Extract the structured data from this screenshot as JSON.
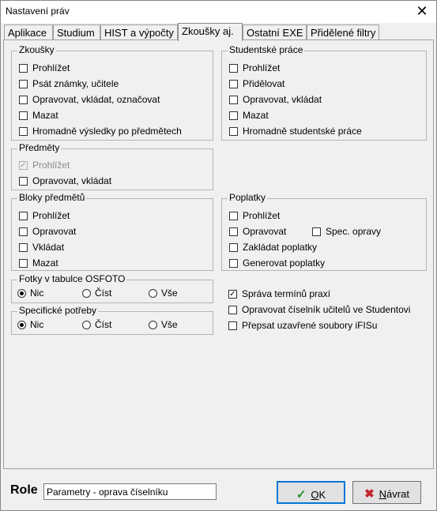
{
  "window": {
    "title": "Nastavení práv",
    "close_symbol": "✕"
  },
  "tabs": [
    "Aplikace",
    "Studium",
    "HIST a výpočty",
    "Zkoušky aj.",
    "Ostatní EXE",
    "Přidělené filtry"
  ],
  "active_tab": "Zkoušky aj.",
  "zkousky": {
    "title": "Zkoušky",
    "items": [
      "Prohlížet",
      "Psát známky, učitele",
      "Opravovat, vkládat, označovat",
      "Mazat",
      "Hromadně výsledky po předmětech"
    ]
  },
  "studentske": {
    "title": "Studentské práce",
    "items": [
      "Prohlížet",
      "Přidělovat",
      "Opravovat, vkládat",
      "Mazat",
      "Hromadně studentské práce"
    ]
  },
  "predmety": {
    "title": "Předměty",
    "items": [
      "Prohlížet",
      "Opravovat, vkládat"
    ]
  },
  "bloky": {
    "title": "Bloky předmětů",
    "items": [
      "Prohlížet",
      "Opravovat",
      "Vkládat",
      "Mazat"
    ]
  },
  "poplatky": {
    "title": "Poplatky",
    "items": [
      "Prohlížet",
      "Opravovat",
      "Spec. opravy",
      "Zakládat poplatky",
      "Generovat poplatky"
    ]
  },
  "fotky": {
    "title": "Fotky v tabulce OSFOTO",
    "options": [
      "Nic",
      "Číst",
      "Vše"
    ],
    "selected": "Nic"
  },
  "specificke": {
    "title": "Specifické potřeby",
    "options": [
      "Nic",
      "Číst",
      "Vše"
    ],
    "selected": "Nic"
  },
  "other": {
    "items": [
      "Správa termínů praxí",
      "Opravovat číselník učitelů ve Studentovi",
      "Přepsat uzavřené soubory iFISu"
    ]
  },
  "role": {
    "label": "Role",
    "value": "Parametry - oprava číselníku"
  },
  "buttons": {
    "ok_prefix": "",
    "ok_accel": "O",
    "ok_rest": "K",
    "back_accel": "N",
    "back_rest": "ávrat"
  },
  "check_mark": "✓"
}
